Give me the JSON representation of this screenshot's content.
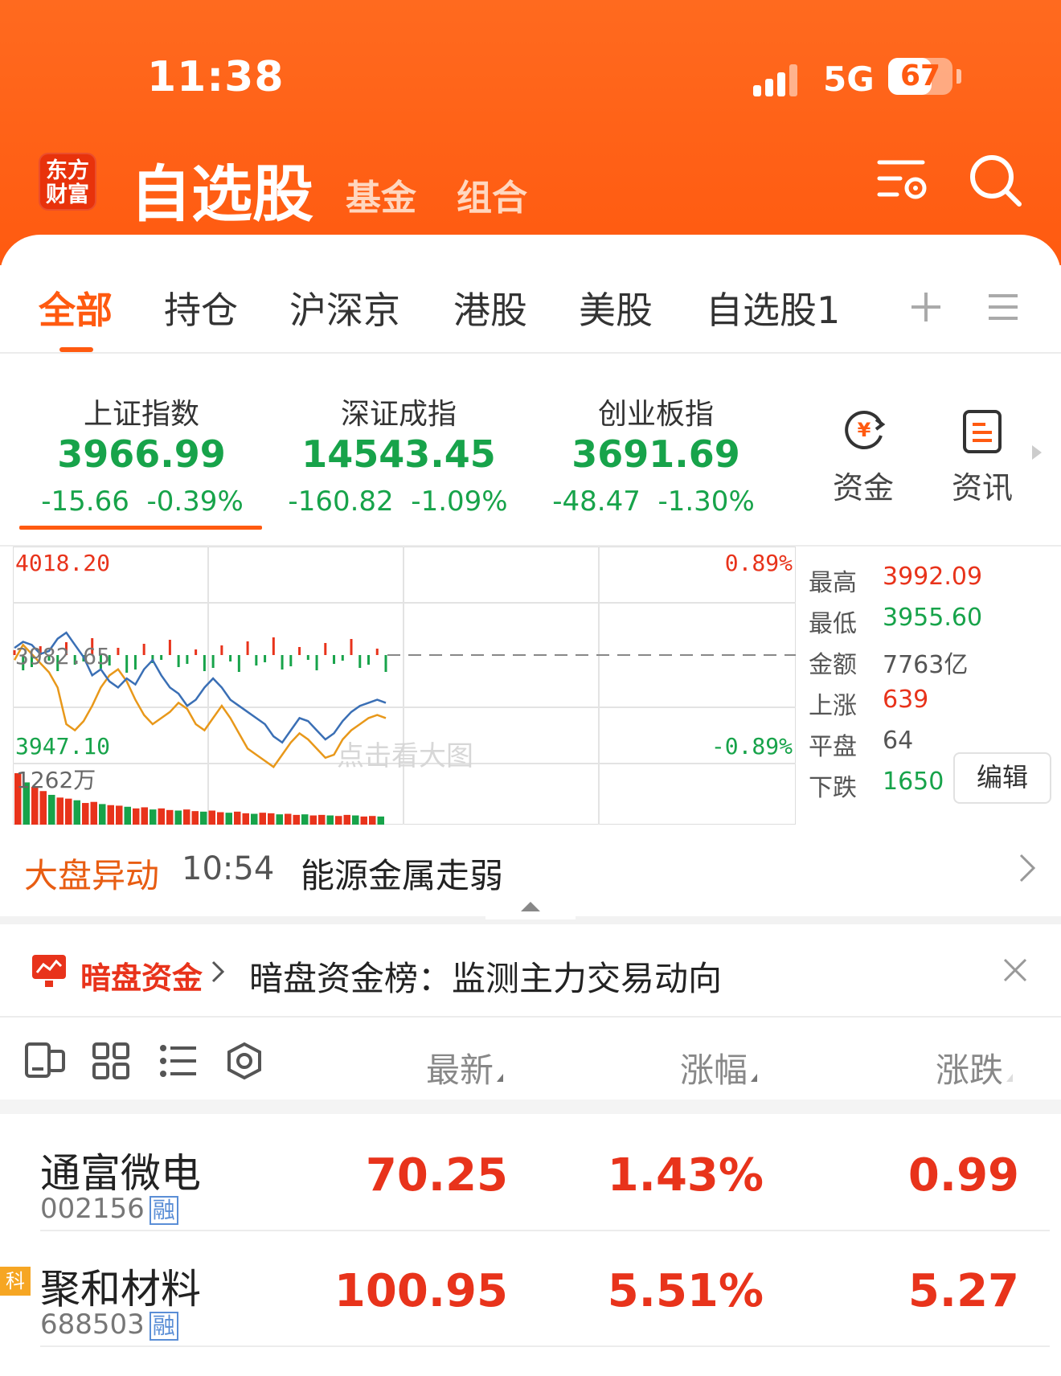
{
  "status_bar": {
    "time": "11:38",
    "network": "5G",
    "battery": "67",
    "battery_level": 0.67
  },
  "header": {
    "logo_line1": "东方",
    "logo_line2": "财富",
    "title": "自选股",
    "tabs": [
      "基金",
      "组合"
    ]
  },
  "category_tabs": [
    "全部",
    "持仓",
    "沪深京",
    "港股",
    "美股",
    "自选股1"
  ],
  "indices": [
    {
      "name": "上证指数",
      "value": "3966.99",
      "change": "-15.66",
      "pct": "-0.39%"
    },
    {
      "name": "深证成指",
      "value": "14543.45",
      "change": "-160.82",
      "pct": "-1.09%"
    },
    {
      "name": "创业板指",
      "value": "3691.69",
      "change": "-48.47",
      "pct": "-1.30%"
    }
  ],
  "quick_buttons": [
    {
      "label": "资金",
      "icon": "capital-flow-icon"
    },
    {
      "label": "资讯",
      "icon": "news-doc-icon"
    }
  ],
  "chart": {
    "high_label": "4018.20",
    "low_label": "3947.10",
    "high_pct": "0.89%",
    "low_pct": "-0.89%",
    "prev_close_label": "3982.65",
    "volume_label": "1262万",
    "watermark": "点击看大图"
  },
  "chart_data": {
    "type": "line",
    "series": [
      {
        "values": [
          3985,
          3987,
          3986,
          3983,
          3984,
          3988,
          3990,
          3986,
          3982,
          3976,
          3978,
          3974,
          3972,
          3975,
          3973,
          3978,
          3981,
          3976,
          3972,
          3970,
          3966,
          3968,
          3972,
          3975,
          3972,
          3968,
          3966,
          3964,
          3962,
          3960,
          3956,
          3954,
          3958,
          3962,
          3961,
          3958,
          3955,
          3957,
          3961,
          3964,
          3966,
          3967,
          3968,
          3967
        ]
      },
      {
        "values": [
          3981,
          3986,
          3983,
          3980,
          3977,
          3972,
          3960,
          3958,
          3961,
          3966,
          3972,
          3976,
          3978,
          3974,
          3968,
          3963,
          3960,
          3962,
          3964,
          3967,
          3965,
          3960,
          3958,
          3962,
          3966,
          3962,
          3957,
          3952,
          3950,
          3948,
          3946,
          3950,
          3954,
          3957,
          3955,
          3952,
          3949,
          3950,
          3955,
          3958,
          3960,
          3962,
          3963,
          3962
        ]
      }
    ],
    "volume": [
      95,
      78,
      70,
      62,
      55,
      50,
      48,
      45,
      40,
      42,
      38,
      36,
      35,
      33,
      30,
      32,
      28,
      30,
      27,
      26,
      28,
      25,
      24,
      26,
      23,
      22,
      24,
      21,
      20,
      22,
      21,
      19,
      20,
      18,
      19,
      17,
      18,
      17,
      16,
      18,
      17,
      15,
      16,
      15
    ],
    "prev_close": 3982.65,
    "ylim": [
      3947.1,
      4018.2
    ],
    "grid": true
  },
  "market_stats": [
    {
      "label": "最高",
      "value": "3992.09",
      "color": "red"
    },
    {
      "label": "最低",
      "value": "3955.60",
      "color": "green"
    },
    {
      "label": "金额",
      "value": "7763亿",
      "color": "gray"
    },
    {
      "label": "上涨",
      "value": "639",
      "color": "red"
    },
    {
      "label": "平盘",
      "value": "64",
      "color": "gray"
    },
    {
      "label": "下跌",
      "value": "1650",
      "color": "green"
    }
  ],
  "edit_label": "编辑",
  "news": {
    "tag": "大盘异动",
    "time": "10:54",
    "text": "能源金属走弱"
  },
  "banner": {
    "label": "暗盘资金",
    "text": "暗盘资金榜：监测主力交易动向"
  },
  "list_header": {
    "cols": [
      "最新",
      "涨幅",
      "涨跌"
    ]
  },
  "stocks": [
    {
      "name": "通富微电",
      "code": "002156",
      "badge": "融",
      "price": "70.25",
      "pct": "1.43%",
      "change": "0.99"
    },
    {
      "name": "聚和材料",
      "code": "688503",
      "badge": "融",
      "tag": "科",
      "price": "100.95",
      "pct": "5.51%",
      "change": "5.27"
    }
  ],
  "colors": {
    "brand": "#ff5a10",
    "up": "#e8331b",
    "down": "#17a34a",
    "line_blue": "#3a6fb5",
    "line_orange": "#e8981a"
  }
}
